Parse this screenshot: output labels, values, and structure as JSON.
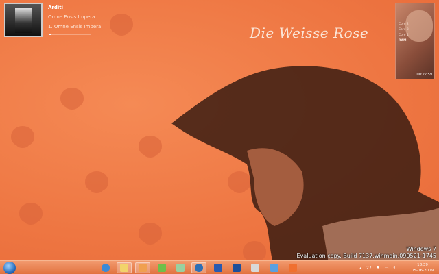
{
  "wallpaper": {
    "title": "Die Weisse Rose"
  },
  "media_player": {
    "artist": "Arditi",
    "album": "Omne Ensis Impera",
    "track": "1. Omne Ensis Impera",
    "progress": 0.05
  },
  "system_gadget": {
    "labels": [
      "Core 2",
      "Core 3",
      "Core 4",
      "RAM"
    ],
    "time": "00:22:59"
  },
  "watermark": {
    "line1": "Windows 7",
    "line2": "Evaluation copy. Build 7137.winmain.090521-1745"
  },
  "taskbar": {
    "pinned": [
      {
        "name": "internet-explorer-icon",
        "color": "#3b8ad8"
      },
      {
        "name": "explorer-folder-icon",
        "color": "#f2d36b"
      },
      {
        "name": "media-player-icon",
        "color": "#f0a050"
      },
      {
        "name": "messenger-icon",
        "color": "#6fbf4a"
      },
      {
        "name": "mail-icon",
        "color": "#9ad0a0"
      },
      {
        "name": "thunderbird-icon",
        "color": "#2f6fb5"
      },
      {
        "name": "word-icon",
        "color": "#2a5ab0"
      },
      {
        "name": "photoshop-icon",
        "color": "#1d4f9a"
      },
      {
        "name": "paint-icon",
        "color": "#d8d8d8"
      },
      {
        "name": "network-icon",
        "color": "#5aa0e0"
      },
      {
        "name": "app-icon",
        "color": "#f07030"
      }
    ],
    "tray": {
      "show_hidden": "▴",
      "temp": "27"
    },
    "clock": {
      "time": "18:39",
      "date": "05-06-2009"
    }
  }
}
